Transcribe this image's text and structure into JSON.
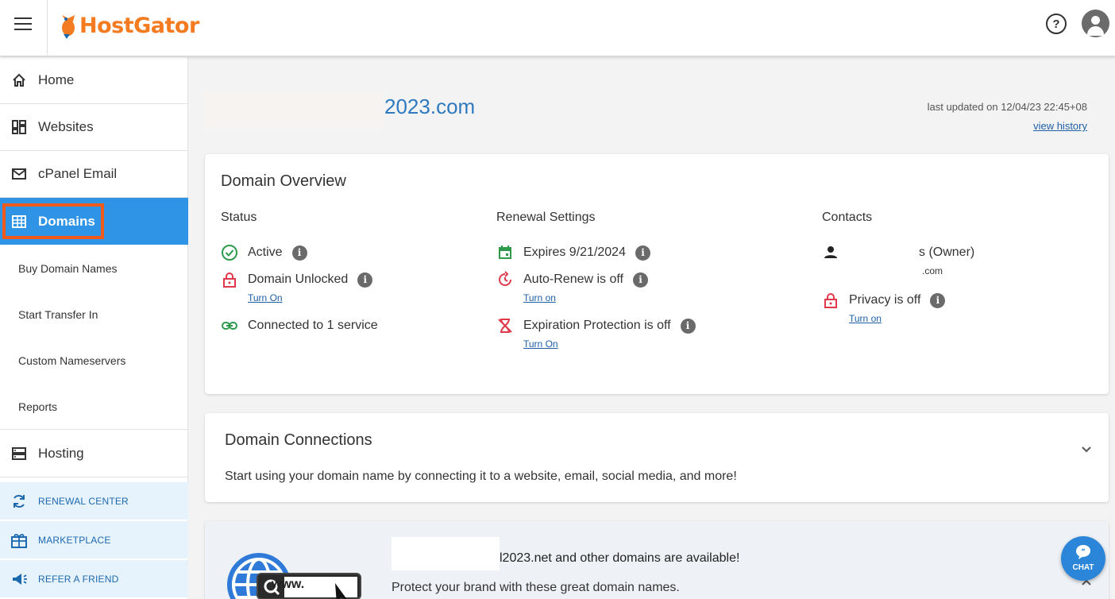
{
  "header": {
    "brand": "HostGator",
    "help_symbol": "?",
    "icons": [
      "hamburger-menu-icon",
      "gator-logo-icon",
      "help-icon",
      "account-avatar-icon"
    ]
  },
  "sidebar": {
    "items": [
      {
        "label": "Home",
        "icon": "home-icon"
      },
      {
        "label": "Websites",
        "icon": "dashboard-icon"
      },
      {
        "label": "cPanel Email",
        "icon": "mail-icon"
      },
      {
        "label": "Domains",
        "icon": "domains-icon",
        "active": true
      },
      {
        "label": "Hosting",
        "icon": "server-icon"
      }
    ],
    "sub_items": [
      "Buy Domain Names",
      "Start Transfer In",
      "Custom Nameservers",
      "Reports"
    ],
    "promos": [
      {
        "label": "RENEWAL CENTER",
        "icon": "refresh-icon"
      },
      {
        "label": "MARKETPLACE",
        "icon": "gift-icon"
      },
      {
        "label": "REFER A FRIEND",
        "icon": "megaphone-icon"
      }
    ]
  },
  "page": {
    "domain_suffix": "2023.com",
    "last_updated": "last updated on 12/04/23 22:45+08",
    "view_history": "view history"
  },
  "overview": {
    "title": "Domain Overview",
    "status": {
      "title": "Status",
      "active": "Active",
      "unlocked": "Domain Unlocked",
      "unlocked_link": "Turn On",
      "connected": "Connected to 1 service"
    },
    "renewal": {
      "title": "Renewal Settings",
      "expires": "Expires 9/21/2024",
      "auto_renew": "Auto-Renew is off",
      "auto_renew_link": "Turn on",
      "expiration": "Expiration Protection is off",
      "expiration_link": "Turn On"
    },
    "contacts": {
      "title": "Contacts",
      "owner_suffix": "s (Owner)",
      "email_suffix": ".com",
      "privacy": "Privacy is off",
      "privacy_link": "Turn on"
    },
    "info_symbol": "i"
  },
  "connections": {
    "title": "Domain Connections",
    "description": "Start using your domain name by connecting it to a website, email, social media, and more!"
  },
  "suggest": {
    "headline": "l2023.net and other domains are available!",
    "subline": "Protect your brand with these great domain names.",
    "www_label": "www."
  },
  "chat": {
    "label": "CHAT"
  },
  "colors": {
    "brand": "#f47b20",
    "active_nav": "#2f94e6",
    "highlight": "#f05a1a",
    "link": "#1f5fa6",
    "success": "#2e9a4e",
    "danger": "#e0394b"
  }
}
